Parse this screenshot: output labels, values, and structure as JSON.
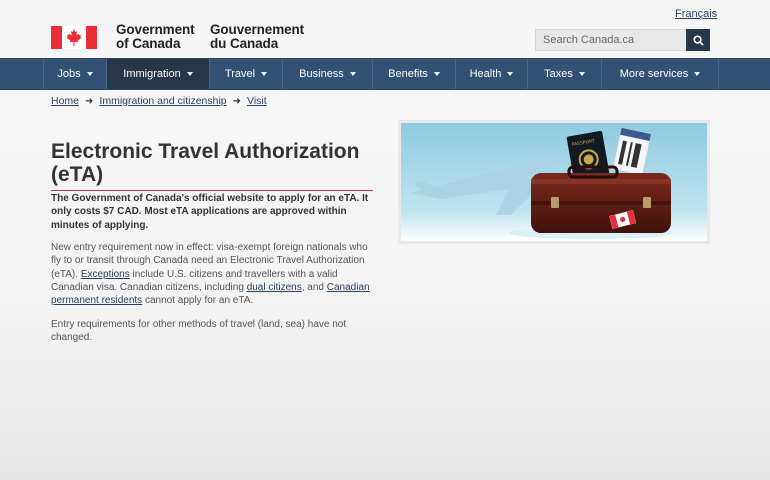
{
  "header": {
    "gov_en_line1": "Government",
    "gov_en_line2": "of Canada",
    "gov_fr_line1": "Gouvernement",
    "gov_fr_line2": "du Canada",
    "language_link": "Français",
    "search_placeholder": "Search Canada.ca"
  },
  "menu": {
    "items": [
      {
        "label": "Jobs"
      },
      {
        "label": "Immigration"
      },
      {
        "label": "Travel"
      },
      {
        "label": "Business"
      },
      {
        "label": "Benefits"
      },
      {
        "label": "Health"
      },
      {
        "label": "Taxes"
      },
      {
        "label": "More services"
      }
    ]
  },
  "breadcrumb": {
    "items": [
      "Home",
      "Immigration and citizenship",
      "Visit"
    ]
  },
  "main": {
    "title": "Electronic Travel Authorization (eTA)",
    "lead": "The Government of Canada's official website to apply for an eTA. It only costs $7 CAD. Most eTA applications are approved within minutes of applying.",
    "p1_part1": "New entry requirement now in effect: visa-exempt foreign nationals who fly to or transit through Canada need an Electronic Travel Authorization (eTA). ",
    "p1_link1": "Exceptions",
    "p1_part2": " include U.S. citizens and travellers with a valid Canadian visa. Canadian citizens, including ",
    "p1_link2": "dual citizens",
    "p1_part3": ", and ",
    "p1_link3": "Canadian permanent residents",
    "p1_part4": " cannot apply for an eTA.",
    "p2": "Entry requirements for other methods of travel (land, sea) have not changed."
  },
  "hero": {
    "passport_label": "PASSPORT"
  },
  "colors": {
    "menu_bg": "#335075",
    "menu_active": "#26374a",
    "link": "#284162",
    "title_rule": "#af3c43",
    "flag_red": "#eb2d37"
  }
}
